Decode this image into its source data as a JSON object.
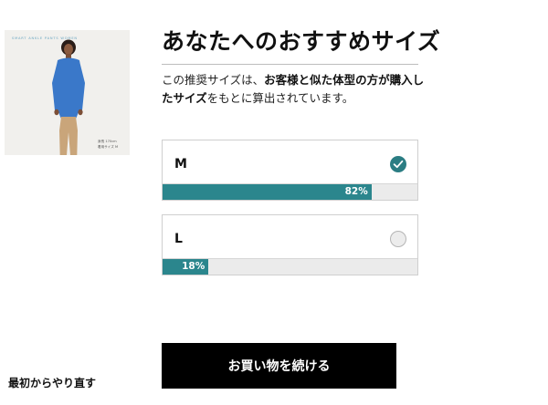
{
  "heading": "あなたへのおすすめサイズ",
  "description": {
    "part1": "この推奨サイズは、",
    "part2_bold": "お客様と似た体型の方が購入したサイズ",
    "part3": "をもとに算出されています。"
  },
  "product_image": {
    "caption_top": "SMART ANKLE PANTS WOMEN",
    "caption_line1": "身長 170cm",
    "caption_line2": "着用サイズ M"
  },
  "sizes": [
    {
      "label": "M",
      "percent": 82,
      "percent_label": "82%",
      "selected": true
    },
    {
      "label": "L",
      "percent": 18,
      "percent_label": "18%",
      "selected": false
    }
  ],
  "primary_button": "お買い物を続ける",
  "restart_link": "最初からやり直す",
  "colors": {
    "accent": "#2b868d",
    "checked_radio": "#2b7d83",
    "button_bg": "#000000",
    "product_bg": "#f1f0ed",
    "sweater": "#3a78c9",
    "pants": "#c9a57a"
  }
}
